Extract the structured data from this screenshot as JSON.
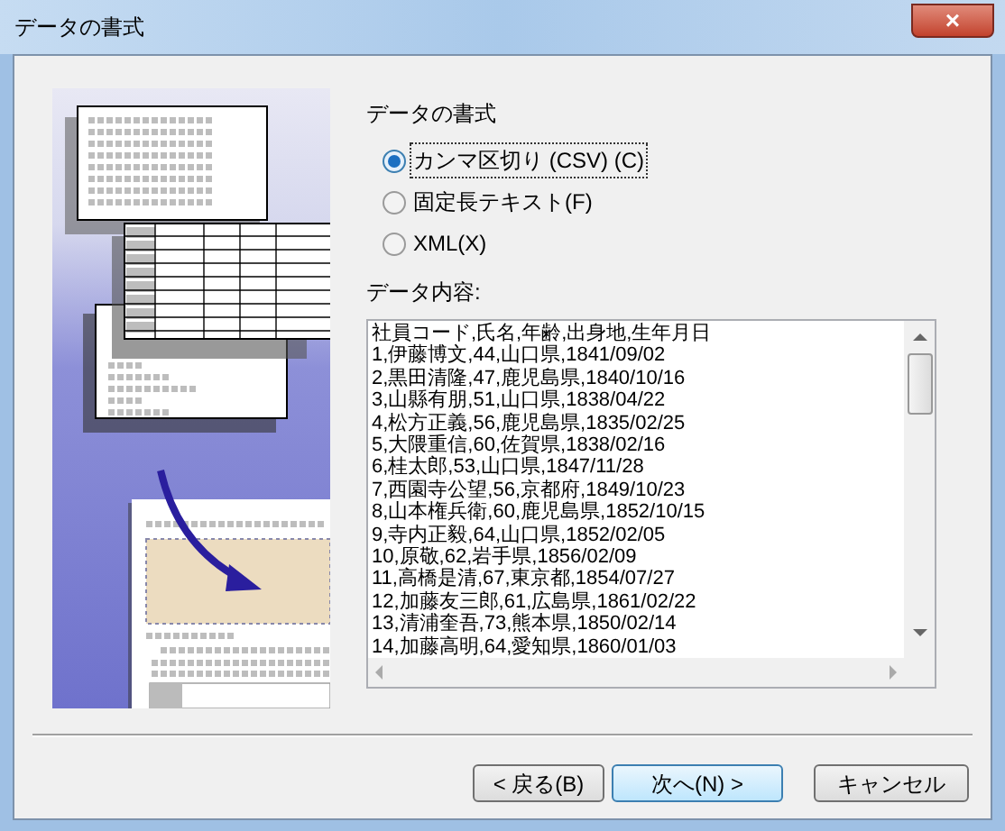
{
  "window": {
    "title": "データの書式",
    "close": "×"
  },
  "format_group": {
    "label": "データの書式",
    "options": [
      {
        "label": "カンマ区切り (CSV) (C)",
        "selected": true
      },
      {
        "label": "固定長テキスト(F)",
        "selected": false
      },
      {
        "label": "XML(X)",
        "selected": false
      }
    ]
  },
  "content": {
    "label": "データ内容:",
    "lines": [
      "社員コード,氏名,年齢,出身地,生年月日",
      "1,伊藤博文,44,山口県,1841/09/02",
      "2,黒田清隆,47,鹿児島県,1840/10/16",
      "3,山縣有朋,51,山口県,1838/04/22",
      "4,松方正義,56,鹿児島県,1835/02/25",
      "5,大隈重信,60,佐賀県,1838/02/16",
      "6,桂太郎,53,山口県,1847/11/28",
      "7,西園寺公望,56,京都府,1849/10/23",
      "8,山本権兵衛,60,鹿児島県,1852/10/15",
      "9,寺内正毅,64,山口県,1852/02/05",
      "10,原敬,62,岩手県,1856/02/09",
      "11,高橋是清,67,東京都,1854/07/27",
      "12,加藤友三郎,61,広島県,1861/02/22",
      "13,清浦奎吾,73,熊本県,1850/02/14",
      "14,加藤高明,64,愛知県,1860/01/03"
    ]
  },
  "buttons": [
    {
      "label": "< 戻る(B)",
      "selected": false
    },
    {
      "label": "次へ(N) >",
      "selected": true
    },
    {
      "label": "キャンセル",
      "selected": false
    }
  ]
}
